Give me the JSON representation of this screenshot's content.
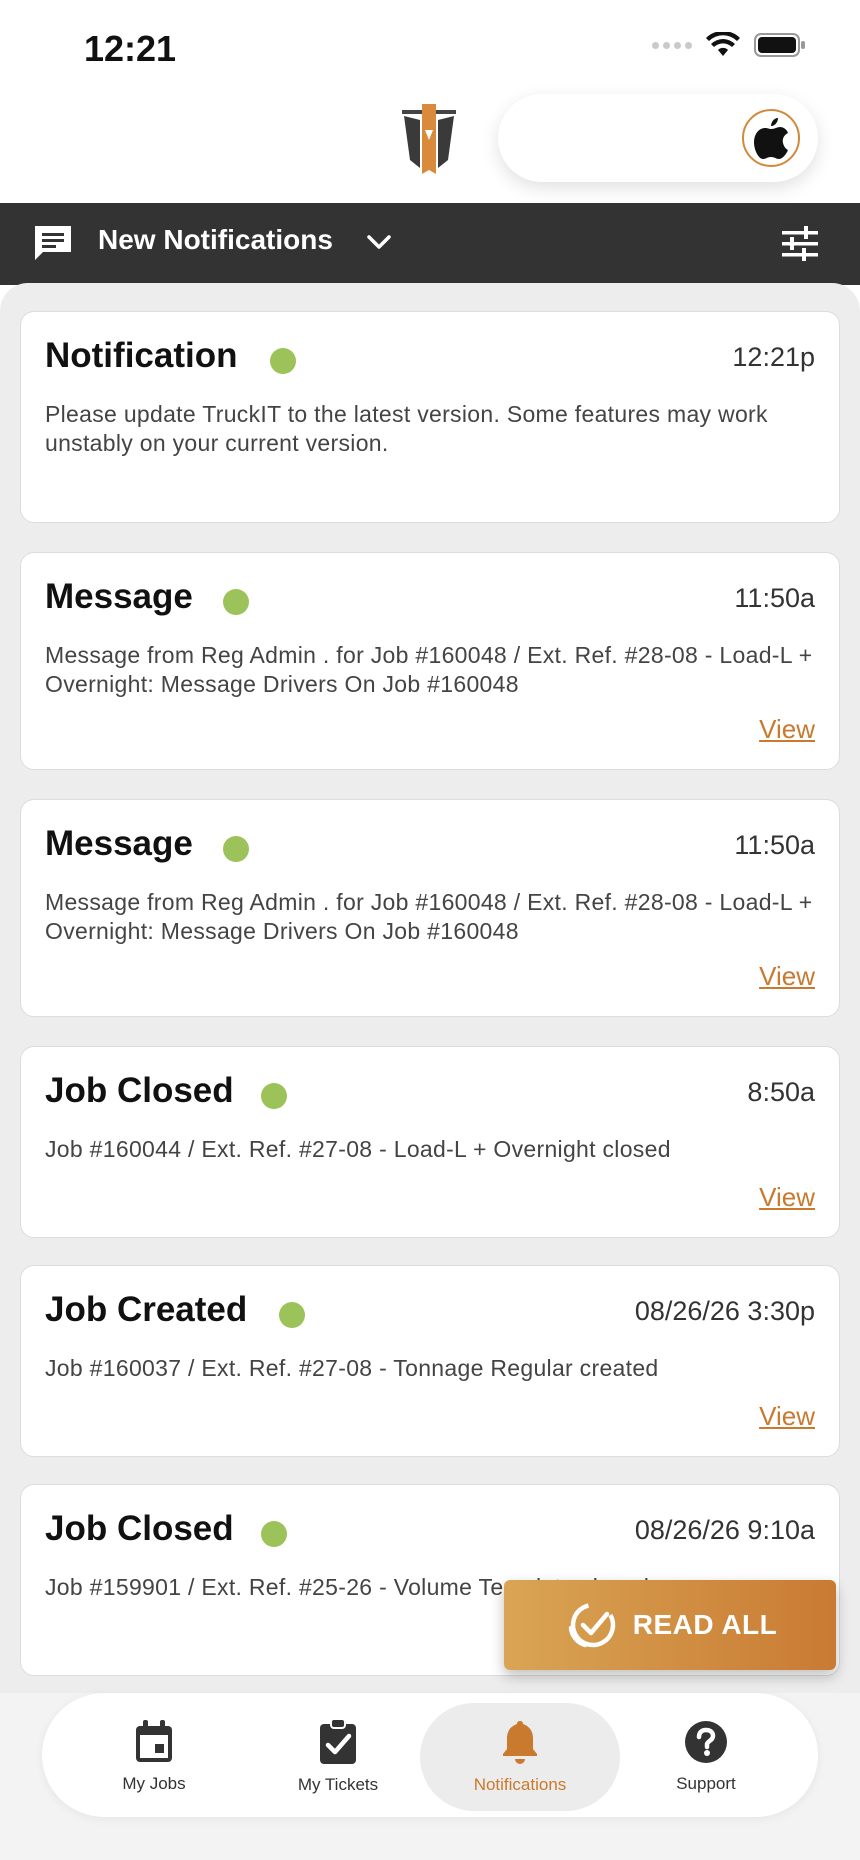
{
  "status_bar": {
    "time": "12:21"
  },
  "toolbar": {
    "title": "New Notifications"
  },
  "notifications": [
    {
      "title": "Notification",
      "time": "12:21p",
      "body": "Please update TruckIT to the latest version. Some features may work unstably on your current version.",
      "view_label": ""
    },
    {
      "title": "Message",
      "time": "11:50a",
      "body": "Message from Reg Admin . for Job #160048 / Ext. Ref. #28-08 - Load-L + Overnight: Message Drivers On Job #160048",
      "view_label": "View"
    },
    {
      "title": "Message",
      "time": "11:50a",
      "body": "Message from Reg Admin . for Job #160048 / Ext. Ref. #28-08 - Load-L + Overnight: Message Drivers On Job #160048",
      "view_label": "View"
    },
    {
      "title": "Job Closed",
      "time": "8:50a",
      "body": "Job #160044 / Ext. Ref. #27-08 - Load-L + Overnight closed",
      "view_label": "View"
    },
    {
      "title": "Job Created",
      "time": "08/26/26 3:30p",
      "body": "Job #160037 / Ext. Ref. #27-08 - Tonnage Regular created",
      "view_label": "View"
    },
    {
      "title": "Job Closed",
      "time": "08/26/26 9:10a",
      "body": "Job #159901 / Ext. Ref. #25-26 - Volume Template closed",
      "view_label": ""
    }
  ],
  "read_all_label": "READ ALL",
  "nav": {
    "items": [
      {
        "label": "My Jobs",
        "icon": "calendar-icon"
      },
      {
        "label": "My Tickets",
        "icon": "clipboard-check-icon"
      },
      {
        "label": "Notifications",
        "icon": "bell-icon"
      },
      {
        "label": "Support",
        "icon": "help-icon"
      }
    ],
    "active": "Notifications"
  },
  "colors": {
    "accent": "#c97a2f",
    "toolbar_bg": "#333333",
    "unread_dot": "#9bc35a",
    "content_bg": "#ededed"
  }
}
